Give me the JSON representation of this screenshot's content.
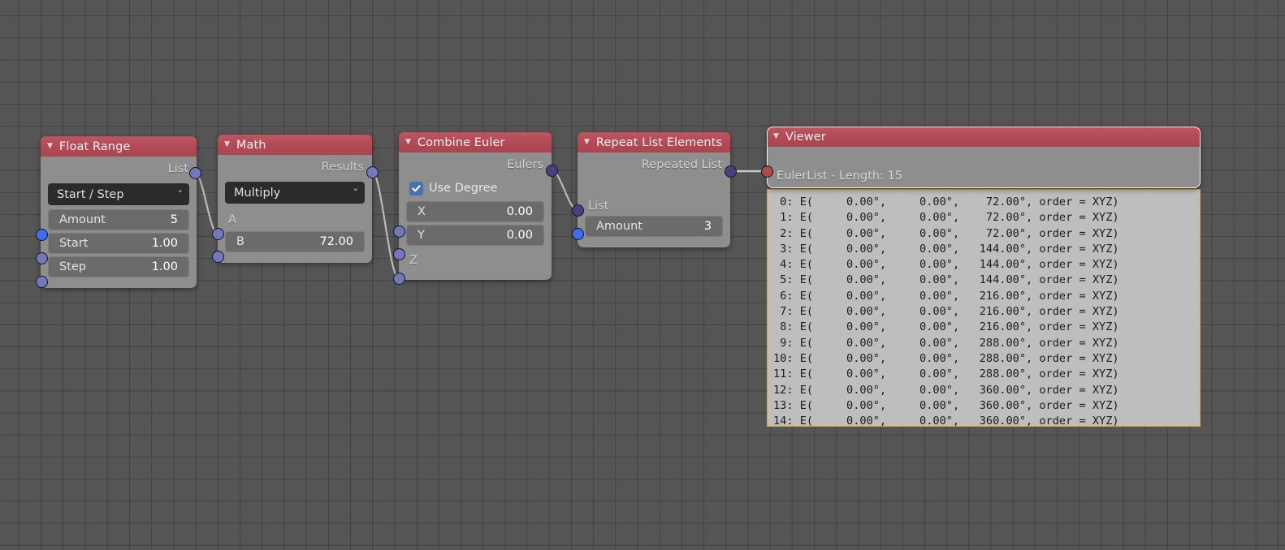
{
  "app": {
    "editor": "node-editor",
    "background_color": "#555555",
    "grid_color": "#3f3f3f"
  },
  "nodes": [
    {
      "id": "float_range",
      "title": "Float Range",
      "header_color": "#b04a55",
      "collapse_icon": "triangle-down-icon",
      "outputs": [
        {
          "label": "List",
          "socket_color": "#7377bd"
        }
      ],
      "dropdown": {
        "value": "Start / Step",
        "chevron": "chevron-down-icon"
      },
      "fields": [
        {
          "label": "Amount",
          "value": "5",
          "socket_color": "#3f6df0"
        },
        {
          "label": "Start",
          "value": "1.00",
          "socket_color": "#7377bd"
        },
        {
          "label": "Step",
          "value": "1.00",
          "socket_color": "#7377bd"
        }
      ]
    },
    {
      "id": "math",
      "title": "Math",
      "header_color": "#b04a55",
      "collapse_icon": "triangle-down-icon",
      "outputs": [
        {
          "label": "Results",
          "socket_color": "#7377bd"
        }
      ],
      "dropdown": {
        "value": "Multiply",
        "chevron": "chevron-down-icon"
      },
      "inputs": [
        {
          "label": "A",
          "socket_color": "#7377bd"
        }
      ],
      "fields": [
        {
          "label": "B",
          "value": "72.00",
          "socket_color": "#7377bd"
        }
      ]
    },
    {
      "id": "combine_euler",
      "title": "Combine Euler",
      "header_color": "#b04a55",
      "collapse_icon": "triangle-down-icon",
      "outputs": [
        {
          "label": "Eulers",
          "socket_color": "#4d3e82"
        }
      ],
      "checkbox": {
        "label": "Use Degree",
        "checked": true,
        "color": "#4772b3"
      },
      "fields": [
        {
          "label": "X",
          "value": "0.00",
          "socket_color": "#7377bd"
        },
        {
          "label": "Y",
          "value": "0.00",
          "socket_color": "#7377bd"
        }
      ],
      "inputs": [
        {
          "label": "Z",
          "socket_color": "#7377bd"
        }
      ]
    },
    {
      "id": "repeat_list",
      "title": "Repeat List Elements",
      "header_color": "#b04a55",
      "collapse_icon": "triangle-down-icon",
      "outputs": [
        {
          "label": "Repeated List",
          "socket_color": "#4d3e82"
        }
      ],
      "inputs": [
        {
          "label": "List",
          "socket_color": "#4d3e82"
        }
      ],
      "fields": [
        {
          "label": "Amount",
          "value": "3",
          "socket_color": "#3f6df0"
        }
      ]
    },
    {
      "id": "viewer",
      "title": "Viewer",
      "header_color": "#b04a55",
      "collapse_icon": "triangle-down-icon",
      "selected": true,
      "input_summary": "EulerList - Length: 15",
      "input_socket_color": "#ab4a4a"
    }
  ],
  "viewer_panel": {
    "border_color": "#e0a52e",
    "background_color": "#bebebe",
    "lines": [
      " 0: E(     0.00°,     0.00°,    72.00°, order = XYZ)",
      " 1: E(     0.00°,     0.00°,    72.00°, order = XYZ)",
      " 2: E(     0.00°,     0.00°,    72.00°, order = XYZ)",
      " 3: E(     0.00°,     0.00°,   144.00°, order = XYZ)",
      " 4: E(     0.00°,     0.00°,   144.00°, order = XYZ)",
      " 5: E(     0.00°,     0.00°,   144.00°, order = XYZ)",
      " 6: E(     0.00°,     0.00°,   216.00°, order = XYZ)",
      " 7: E(     0.00°,     0.00°,   216.00°, order = XYZ)",
      " 8: E(     0.00°,     0.00°,   216.00°, order = XYZ)",
      " 9: E(     0.00°,     0.00°,   288.00°, order = XYZ)",
      "10: E(     0.00°,     0.00°,   288.00°, order = XYZ)",
      "11: E(     0.00°,     0.00°,   288.00°, order = XYZ)",
      "12: E(     0.00°,     0.00°,   360.00°, order = XYZ)",
      "13: E(     0.00°,     0.00°,   360.00°, order = XYZ)",
      "14: E(     0.00°,     0.00°,   360.00°, order = XYZ)"
    ]
  },
  "connections": [
    {
      "from": "float_range.List",
      "to": "math.A"
    },
    {
      "from": "math.Results",
      "to": "combine_euler.Z"
    },
    {
      "from": "combine_euler.Eulers",
      "to": "repeat_list.List"
    },
    {
      "from": "repeat_list.RepeatedList",
      "to": "viewer.input"
    }
  ]
}
